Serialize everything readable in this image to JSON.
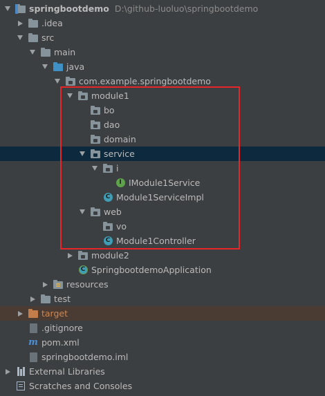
{
  "project_tree": {
    "root": {
      "label": "springbootdemo",
      "path": "D:\\github-luoluo\\springbootdemo"
    },
    "idea": {
      "label": ".idea"
    },
    "src": {
      "label": "src"
    },
    "main": {
      "label": "main"
    },
    "java": {
      "label": "java"
    },
    "package": {
      "label": "com.example.springbootdemo"
    },
    "module1": {
      "label": "module1"
    },
    "bo": {
      "label": "bo"
    },
    "dao": {
      "label": "dao"
    },
    "domain": {
      "label": "domain"
    },
    "service": {
      "label": "service"
    },
    "service_i": {
      "label": "i"
    },
    "imodule1service": {
      "label": "IModule1Service"
    },
    "module1serviceimpl": {
      "label": "Module1ServiceImpl"
    },
    "web": {
      "label": "web"
    },
    "vo": {
      "label": "vo"
    },
    "module1controller": {
      "label": "Module1Controller"
    },
    "module2": {
      "label": "module2"
    },
    "application": {
      "label": "SpringbootdemoApplication"
    },
    "resources": {
      "label": "resources"
    },
    "test": {
      "label": "test"
    },
    "target": {
      "label": "target"
    },
    "gitignore": {
      "label": ".gitignore"
    },
    "pom": {
      "label": "pom.xml"
    },
    "iml": {
      "label": "springbootdemo.iml"
    },
    "external_libraries": {
      "label": "External Libraries"
    },
    "scratches": {
      "label": "Scratches and Consoles"
    }
  },
  "icons": {
    "class_letter": "C",
    "interface_letter": "I",
    "maven_letter": "m"
  },
  "colors": {
    "background": "#3c3f41",
    "selection": "#0d293e",
    "text": "#bbbbbb",
    "excluded_folder": "#d0874f",
    "highlight_box": "#e8262a"
  }
}
